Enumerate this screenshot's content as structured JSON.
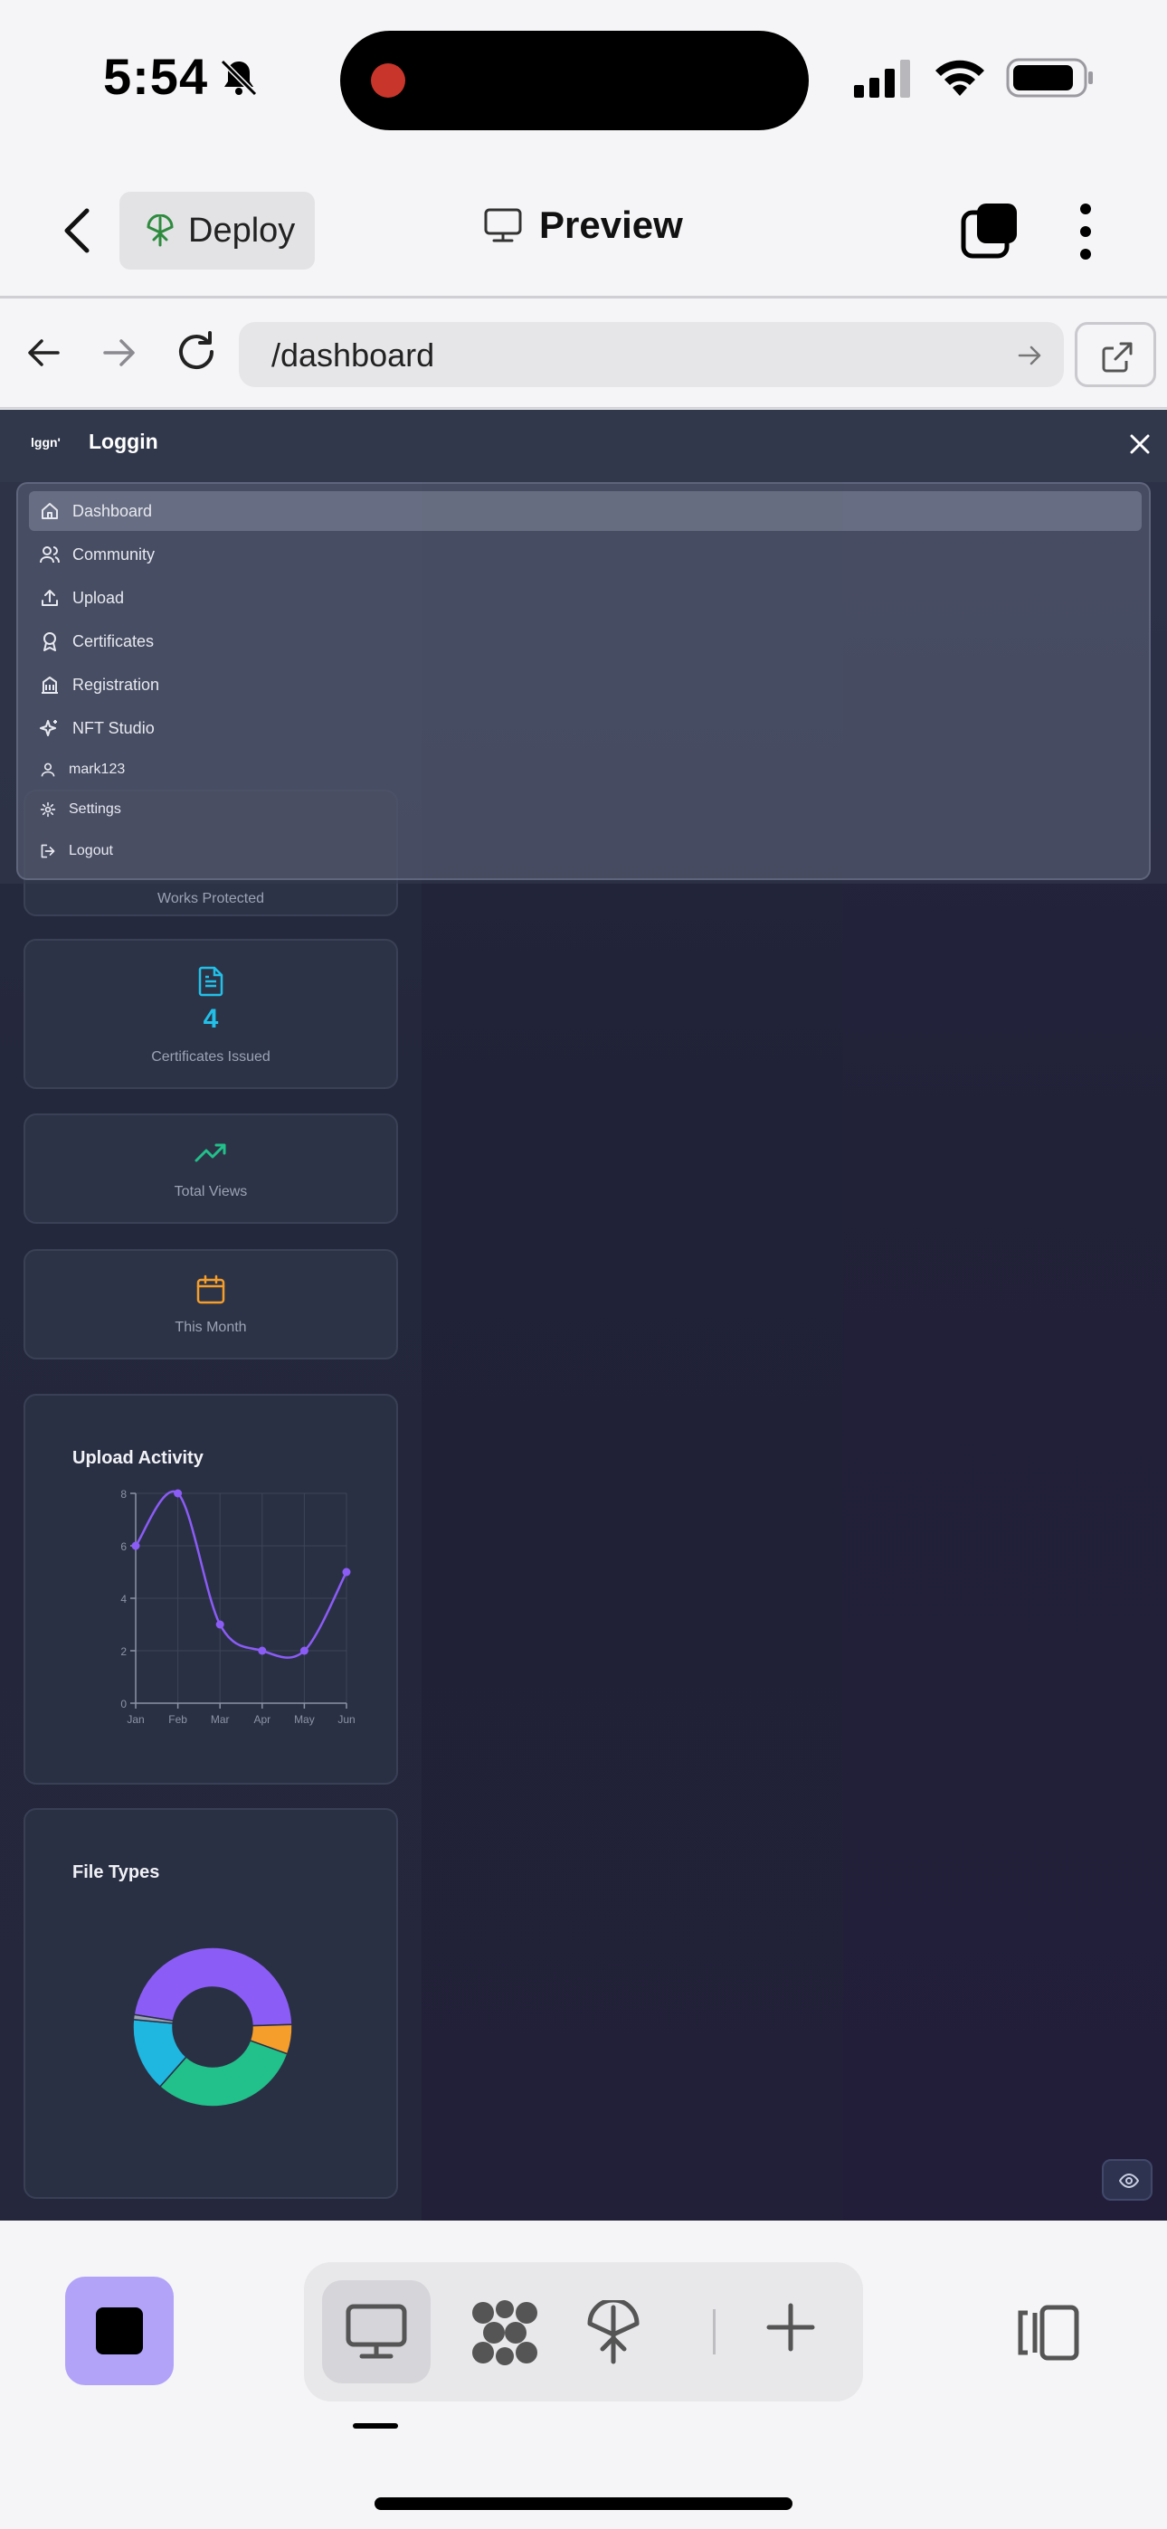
{
  "status_bar": {
    "time": "5:54"
  },
  "header": {
    "deploy_label": "Deploy",
    "preview_label": "Preview"
  },
  "browser": {
    "url": "/dashboard"
  },
  "menu": {
    "brand_logo": "lggn'",
    "brand_name": "Loggin",
    "items": [
      {
        "label": "Dashboard",
        "icon": "home-icon"
      },
      {
        "label": "Community",
        "icon": "users-icon"
      },
      {
        "label": "Upload",
        "icon": "upload-icon"
      },
      {
        "label": "Certificates",
        "icon": "award-icon"
      },
      {
        "label": "Registration",
        "icon": "building-icon"
      },
      {
        "label": "NFT Studio",
        "icon": "sparkles-icon"
      },
      {
        "label": "mark123",
        "icon": "user-icon"
      },
      {
        "label": "Settings",
        "icon": "gear-icon"
      },
      {
        "label": "Logout",
        "icon": "logout-icon"
      }
    ]
  },
  "dashboard": {
    "stats": [
      {
        "label": "Works Protected",
        "value": ""
      },
      {
        "label": "Certificates Issued",
        "value": "4"
      },
      {
        "label": "Total Views",
        "value": ""
      },
      {
        "label": "This Month",
        "value": ""
      }
    ],
    "colors": {
      "accent_cyan": "#22c0e8",
      "accent_green": "#22c08a",
      "accent_orange": "#f59e2b",
      "accent_purple": "#8b5cf6"
    }
  },
  "chart_data": [
    {
      "type": "line",
      "title": "Upload Activity",
      "categories": [
        "Jan",
        "Feb",
        "Mar",
        "Apr",
        "May",
        "Jun"
      ],
      "values": [
        6,
        8,
        3,
        2,
        2,
        5
      ],
      "ylim": [
        0,
        8
      ],
      "yticks": [
        "0",
        "2",
        "4",
        "6",
        "8"
      ],
      "grid": true,
      "color": "#8b5cf6"
    },
    {
      "type": "pie",
      "title": "File Types",
      "donut": true,
      "slices": [
        {
          "value": 47,
          "color": "#8b5cf6"
        },
        {
          "value": 6,
          "color": "#f59e2b"
        },
        {
          "value": 31,
          "color": "#22c08a"
        },
        {
          "value": 15,
          "color": "#1fb6e0"
        },
        {
          "value": 1,
          "color": "#9aa3b5"
        }
      ]
    }
  ]
}
